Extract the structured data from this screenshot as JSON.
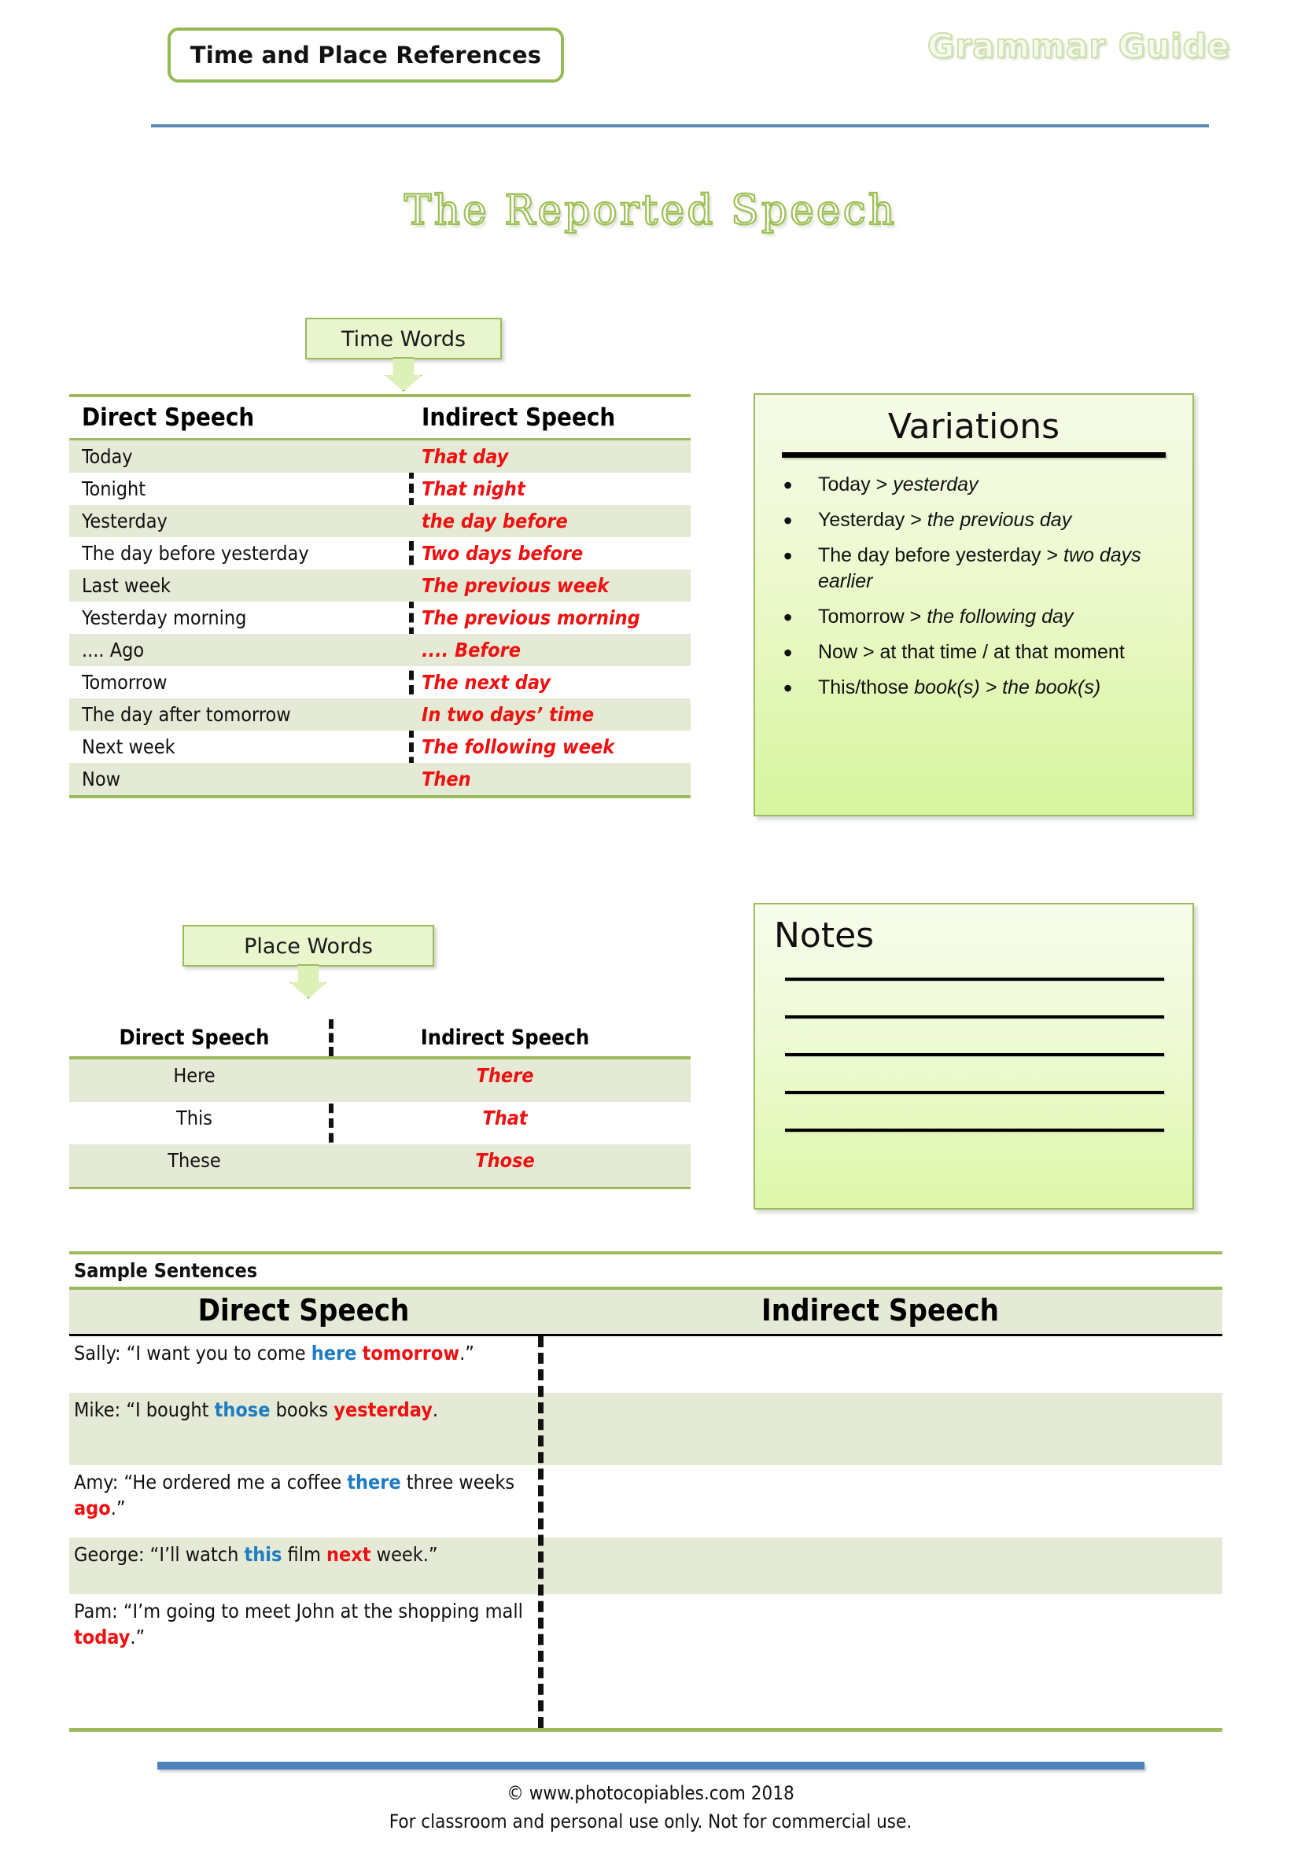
{
  "header": {
    "badge_label": "Time and Place References",
    "right_label": "Grammar Guide"
  },
  "main_title": "The Reported Speech",
  "callouts": {
    "time": "Time Words",
    "place": "Place Words"
  },
  "time_table": {
    "headers": {
      "direct": "Direct Speech",
      "indirect": "Indirect Speech"
    },
    "rows": [
      {
        "direct": "Today",
        "indirect": "That day"
      },
      {
        "direct": "Tonight",
        "indirect": "That night"
      },
      {
        "direct": "Yesterday",
        "indirect": "the day before"
      },
      {
        "direct": "The day before yesterday",
        "indirect": "Two days before"
      },
      {
        "direct": "Last week",
        "indirect": "The previous week"
      },
      {
        "direct": "Yesterday morning",
        "indirect": "The previous morning"
      },
      {
        "direct": ".... Ago",
        "indirect": ".... Before"
      },
      {
        "direct": "Tomorrow",
        "indirect": "The next day"
      },
      {
        "direct": "The day after tomorrow",
        "indirect": "In two days’ time"
      },
      {
        "direct": "Next week",
        "indirect": "The following week"
      },
      {
        "direct": "Now",
        "indirect": "Then"
      }
    ]
  },
  "place_table": {
    "headers": {
      "direct": "Direct Speech",
      "indirect": "Indirect Speech"
    },
    "rows": [
      {
        "direct": "Here",
        "indirect": "There"
      },
      {
        "direct": "This",
        "indirect": "That"
      },
      {
        "direct": "These",
        "indirect": "Those"
      }
    ]
  },
  "variations": {
    "title": "Variations",
    "items": [
      {
        "plain": "Today > ",
        "italic": "yesterday",
        "tail": ""
      },
      {
        "plain": "Yesterday > ",
        "italic": "the previous day",
        "tail": ""
      },
      {
        "plain": "The day before yesterday > ",
        "italic": "two days earlier",
        "tail": ""
      },
      {
        "plain": "Tomorrow > ",
        "italic": "the following day",
        "tail": ""
      },
      {
        "plain": "Now > at that time / at that moment",
        "italic": "",
        "tail": ""
      },
      {
        "plain": "This/those ",
        "italic": "book(s) > the book(s)",
        "tail": ""
      }
    ]
  },
  "notes": {
    "title": "Notes",
    "line_count": 5
  },
  "samples": {
    "section_label": "Sample Sentences",
    "headers": {
      "direct": "Direct Speech",
      "indirect": "Indirect Speech"
    },
    "rows": [
      {
        "parts": [
          {
            "t": "Sally: “I want you to come ",
            "k": ""
          },
          {
            "t": "here",
            "k": "blue"
          },
          {
            "t": " ",
            "k": ""
          },
          {
            "t": "tomorrow",
            "k": "red"
          },
          {
            "t": ".”",
            "k": ""
          }
        ]
      },
      {
        "parts": [
          {
            "t": "Mike: “I bought ",
            "k": ""
          },
          {
            "t": "those",
            "k": "blue"
          },
          {
            "t": " books ",
            "k": ""
          },
          {
            "t": "yesterday",
            "k": "red"
          },
          {
            "t": ".",
            "k": ""
          }
        ]
      },
      {
        "parts": [
          {
            "t": "Amy: “He ordered me a coffee ",
            "k": ""
          },
          {
            "t": "there",
            "k": "blue"
          },
          {
            "t": " three weeks ",
            "k": ""
          },
          {
            "t": "ago",
            "k": "red"
          },
          {
            "t": ".”",
            "k": ""
          }
        ]
      },
      {
        "parts": [
          {
            "t": "George: “I’ll watch ",
            "k": ""
          },
          {
            "t": "this",
            "k": "blue"
          },
          {
            "t": " film ",
            "k": ""
          },
          {
            "t": "next",
            "k": "red"
          },
          {
            "t": " week.”",
            "k": ""
          }
        ]
      },
      {
        "parts": [
          {
            "t": "Pam: “I’m going to meet John at the shopping mall ",
            "k": ""
          },
          {
            "t": "today",
            "k": "red"
          },
          {
            "t": ".”",
            "k": ""
          }
        ]
      }
    ]
  },
  "footer": {
    "line1": "© www.photocopiables.com   2018",
    "line2": "For classroom and personal use only. Not for commercial use."
  },
  "colors": {
    "green_rule": "#9dbb5e",
    "green_fill": "#e4ead5",
    "blue_rule": "#5b8cb8",
    "accent_red": "#ee1111",
    "accent_blue": "#1f7cc2"
  }
}
